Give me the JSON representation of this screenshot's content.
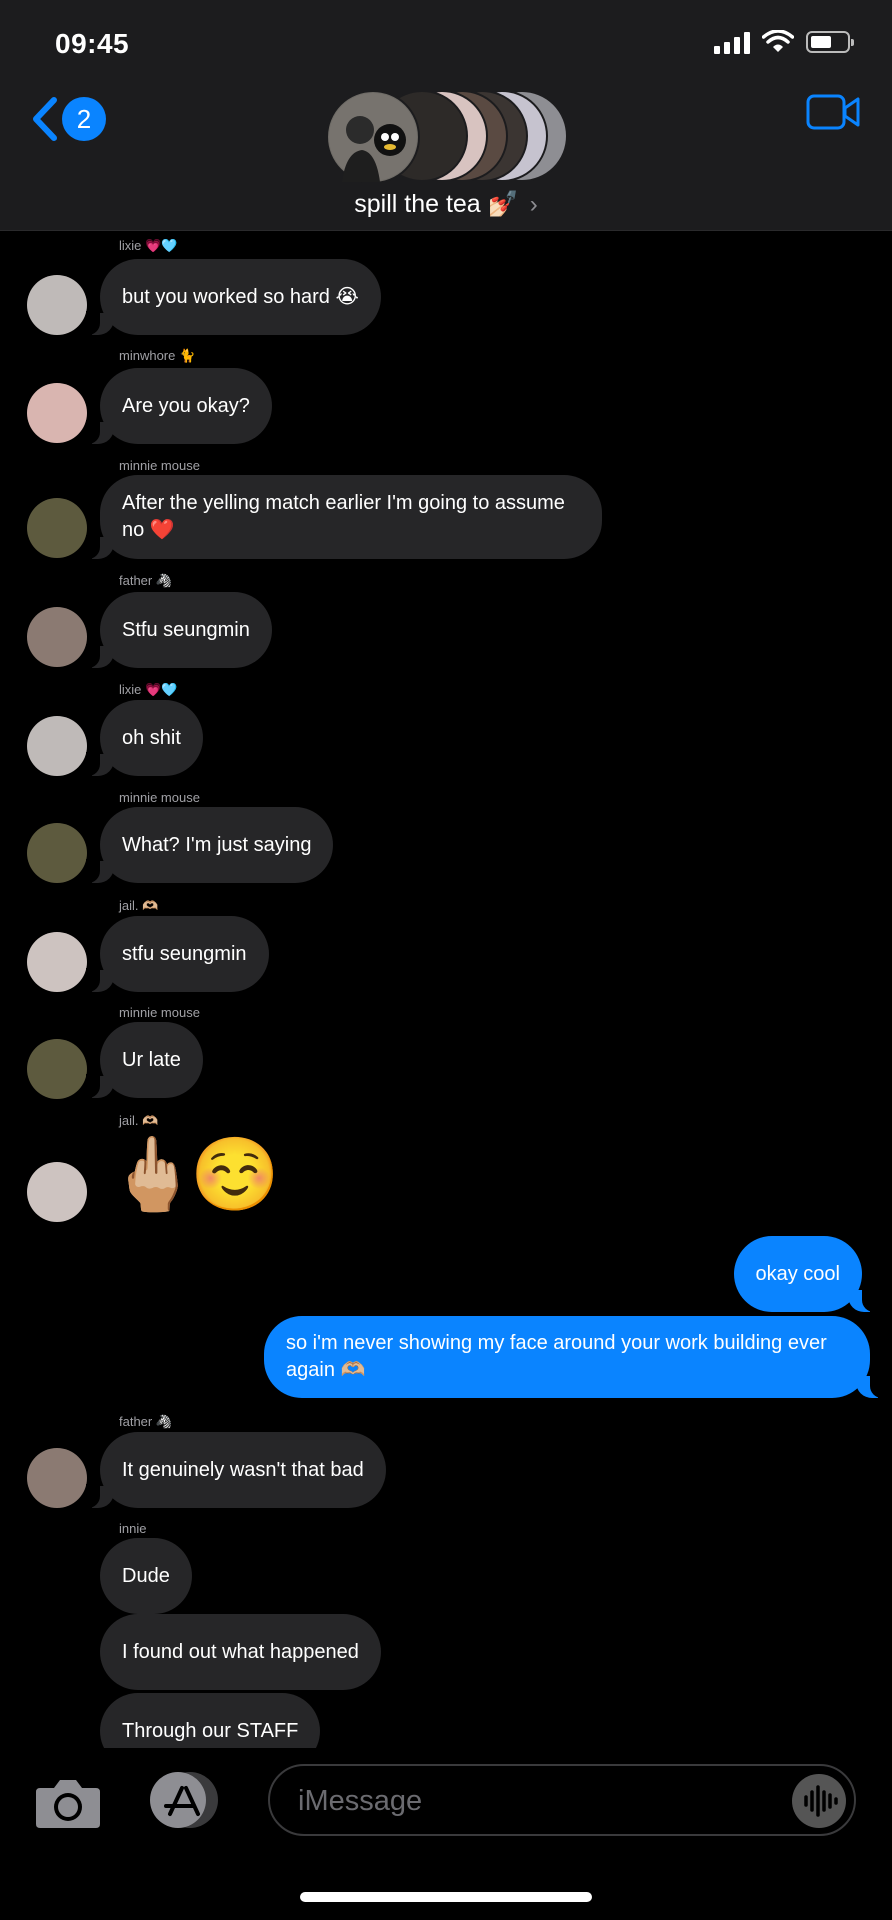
{
  "status": {
    "time": "09:45"
  },
  "header": {
    "back_count": "2",
    "title": "spill the tea 💅🏻"
  },
  "messages": [
    {
      "sender": "lixie 💗🩵",
      "text": "but you worked so hard 😭"
    },
    {
      "sender": "minwhore 🐈",
      "text": "Are you okay?"
    },
    {
      "sender": "minnie mouse",
      "text": "After the yelling match earlier I'm going to assume no ❤️"
    },
    {
      "sender": "father 🦓",
      "text": "Stfu seungmin"
    },
    {
      "sender": "lixie 💗🩵",
      "text": "oh shit"
    },
    {
      "sender": "minnie mouse",
      "text": "What? I'm just saying"
    },
    {
      "sender": "jail. 🫶🏼",
      "text": "stfu seungmin"
    },
    {
      "sender": "minnie mouse",
      "text": "Ur late"
    },
    {
      "sender": "jail. 🫶🏼",
      "emoji_1": "🖕🏼",
      "emoji_2": "☺️"
    },
    {
      "text": "okay cool"
    },
    {
      "text": "so i'm never showing my face around your work building ever again 🫶🏼"
    },
    {
      "sender": "father 🦓",
      "text": "It genuinely wasn't that bad"
    },
    {
      "sender": "innie",
      "text": "Dude"
    },
    {
      "text": "I found out what happened"
    },
    {
      "text": "Through our STAFF"
    }
  ],
  "composer": {
    "placeholder": "iMessage"
  }
}
